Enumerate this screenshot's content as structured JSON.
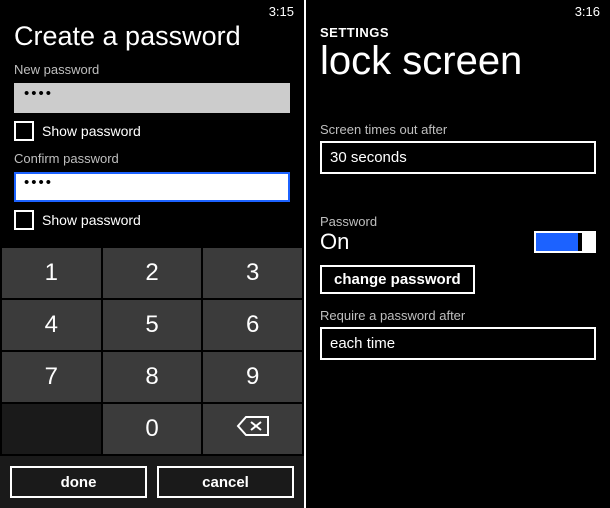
{
  "left": {
    "time": "3:15",
    "title": "Create a password",
    "new_password_label": "New password",
    "new_password_value": "••••",
    "show_password_1": "Show password",
    "confirm_password_label": "Confirm password",
    "confirm_password_value": "••••",
    "show_password_2": "Show password",
    "keys": {
      "1": "1",
      "2": "2",
      "3": "3",
      "4": "4",
      "5": "5",
      "6": "6",
      "7": "7",
      "8": "8",
      "9": "9",
      "0": "0"
    },
    "done": "done",
    "cancel": "cancel"
  },
  "right": {
    "time": "3:16",
    "section": "SETTINGS",
    "title": "lock screen",
    "timeout_label": "Screen times out after",
    "timeout_value": "30 seconds",
    "password_label": "Password",
    "password_state": "On",
    "change_password": "change password",
    "require_label": "Require a password after",
    "require_value": "each time"
  }
}
